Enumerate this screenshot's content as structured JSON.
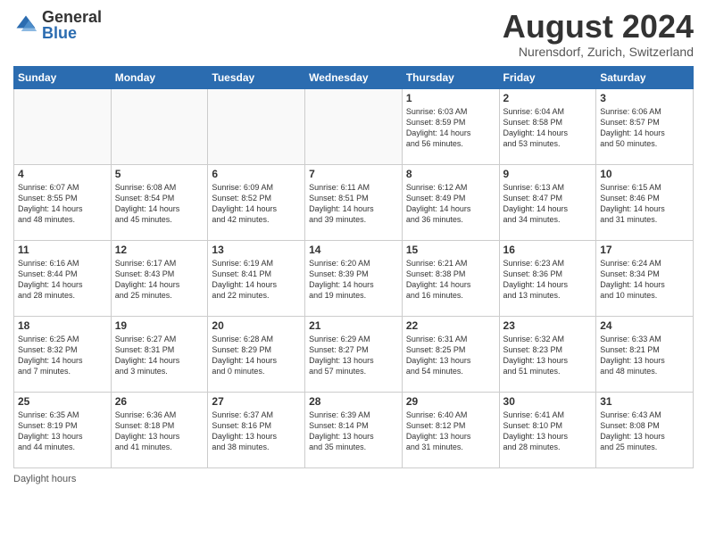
{
  "header": {
    "logo_general": "General",
    "logo_blue": "Blue",
    "month_title": "August 2024",
    "location": "Nurensdorf, Zurich, Switzerland"
  },
  "days_of_week": [
    "Sunday",
    "Monday",
    "Tuesday",
    "Wednesday",
    "Thursday",
    "Friday",
    "Saturday"
  ],
  "weeks": [
    [
      {
        "day": "",
        "info": "",
        "empty": true
      },
      {
        "day": "",
        "info": "",
        "empty": true
      },
      {
        "day": "",
        "info": "",
        "empty": true
      },
      {
        "day": "",
        "info": "",
        "empty": true
      },
      {
        "day": "1",
        "info": "Sunrise: 6:03 AM\nSunset: 8:59 PM\nDaylight: 14 hours\nand 56 minutes.",
        "empty": false
      },
      {
        "day": "2",
        "info": "Sunrise: 6:04 AM\nSunset: 8:58 PM\nDaylight: 14 hours\nand 53 minutes.",
        "empty": false
      },
      {
        "day": "3",
        "info": "Sunrise: 6:06 AM\nSunset: 8:57 PM\nDaylight: 14 hours\nand 50 minutes.",
        "empty": false
      }
    ],
    [
      {
        "day": "4",
        "info": "Sunrise: 6:07 AM\nSunset: 8:55 PM\nDaylight: 14 hours\nand 48 minutes.",
        "empty": false
      },
      {
        "day": "5",
        "info": "Sunrise: 6:08 AM\nSunset: 8:54 PM\nDaylight: 14 hours\nand 45 minutes.",
        "empty": false
      },
      {
        "day": "6",
        "info": "Sunrise: 6:09 AM\nSunset: 8:52 PM\nDaylight: 14 hours\nand 42 minutes.",
        "empty": false
      },
      {
        "day": "7",
        "info": "Sunrise: 6:11 AM\nSunset: 8:51 PM\nDaylight: 14 hours\nand 39 minutes.",
        "empty": false
      },
      {
        "day": "8",
        "info": "Sunrise: 6:12 AM\nSunset: 8:49 PM\nDaylight: 14 hours\nand 36 minutes.",
        "empty": false
      },
      {
        "day": "9",
        "info": "Sunrise: 6:13 AM\nSunset: 8:47 PM\nDaylight: 14 hours\nand 34 minutes.",
        "empty": false
      },
      {
        "day": "10",
        "info": "Sunrise: 6:15 AM\nSunset: 8:46 PM\nDaylight: 14 hours\nand 31 minutes.",
        "empty": false
      }
    ],
    [
      {
        "day": "11",
        "info": "Sunrise: 6:16 AM\nSunset: 8:44 PM\nDaylight: 14 hours\nand 28 minutes.",
        "empty": false
      },
      {
        "day": "12",
        "info": "Sunrise: 6:17 AM\nSunset: 8:43 PM\nDaylight: 14 hours\nand 25 minutes.",
        "empty": false
      },
      {
        "day": "13",
        "info": "Sunrise: 6:19 AM\nSunset: 8:41 PM\nDaylight: 14 hours\nand 22 minutes.",
        "empty": false
      },
      {
        "day": "14",
        "info": "Sunrise: 6:20 AM\nSunset: 8:39 PM\nDaylight: 14 hours\nand 19 minutes.",
        "empty": false
      },
      {
        "day": "15",
        "info": "Sunrise: 6:21 AM\nSunset: 8:38 PM\nDaylight: 14 hours\nand 16 minutes.",
        "empty": false
      },
      {
        "day": "16",
        "info": "Sunrise: 6:23 AM\nSunset: 8:36 PM\nDaylight: 14 hours\nand 13 minutes.",
        "empty": false
      },
      {
        "day": "17",
        "info": "Sunrise: 6:24 AM\nSunset: 8:34 PM\nDaylight: 14 hours\nand 10 minutes.",
        "empty": false
      }
    ],
    [
      {
        "day": "18",
        "info": "Sunrise: 6:25 AM\nSunset: 8:32 PM\nDaylight: 14 hours\nand 7 minutes.",
        "empty": false
      },
      {
        "day": "19",
        "info": "Sunrise: 6:27 AM\nSunset: 8:31 PM\nDaylight: 14 hours\nand 3 minutes.",
        "empty": false
      },
      {
        "day": "20",
        "info": "Sunrise: 6:28 AM\nSunset: 8:29 PM\nDaylight: 14 hours\nand 0 minutes.",
        "empty": false
      },
      {
        "day": "21",
        "info": "Sunrise: 6:29 AM\nSunset: 8:27 PM\nDaylight: 13 hours\nand 57 minutes.",
        "empty": false
      },
      {
        "day": "22",
        "info": "Sunrise: 6:31 AM\nSunset: 8:25 PM\nDaylight: 13 hours\nand 54 minutes.",
        "empty": false
      },
      {
        "day": "23",
        "info": "Sunrise: 6:32 AM\nSunset: 8:23 PM\nDaylight: 13 hours\nand 51 minutes.",
        "empty": false
      },
      {
        "day": "24",
        "info": "Sunrise: 6:33 AM\nSunset: 8:21 PM\nDaylight: 13 hours\nand 48 minutes.",
        "empty": false
      }
    ],
    [
      {
        "day": "25",
        "info": "Sunrise: 6:35 AM\nSunset: 8:19 PM\nDaylight: 13 hours\nand 44 minutes.",
        "empty": false
      },
      {
        "day": "26",
        "info": "Sunrise: 6:36 AM\nSunset: 8:18 PM\nDaylight: 13 hours\nand 41 minutes.",
        "empty": false
      },
      {
        "day": "27",
        "info": "Sunrise: 6:37 AM\nSunset: 8:16 PM\nDaylight: 13 hours\nand 38 minutes.",
        "empty": false
      },
      {
        "day": "28",
        "info": "Sunrise: 6:39 AM\nSunset: 8:14 PM\nDaylight: 13 hours\nand 35 minutes.",
        "empty": false
      },
      {
        "day": "29",
        "info": "Sunrise: 6:40 AM\nSunset: 8:12 PM\nDaylight: 13 hours\nand 31 minutes.",
        "empty": false
      },
      {
        "day": "30",
        "info": "Sunrise: 6:41 AM\nSunset: 8:10 PM\nDaylight: 13 hours\nand 28 minutes.",
        "empty": false
      },
      {
        "day": "31",
        "info": "Sunrise: 6:43 AM\nSunset: 8:08 PM\nDaylight: 13 hours\nand 25 minutes.",
        "empty": false
      }
    ]
  ],
  "footer": {
    "note": "Daylight hours"
  }
}
